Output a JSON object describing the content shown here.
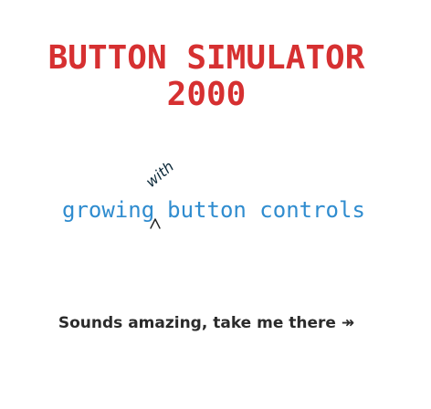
{
  "header": {
    "title_line1": "BUTTON SIMULATOR",
    "title_line2": "2000",
    "title_color": "#d63031"
  },
  "tagline": {
    "word_before": "growing",
    "word_after": "button controls",
    "inserted_word": "with",
    "color": "#2f8ccf"
  },
  "cta": {
    "label": "Sounds amazing, take me there ↠"
  }
}
